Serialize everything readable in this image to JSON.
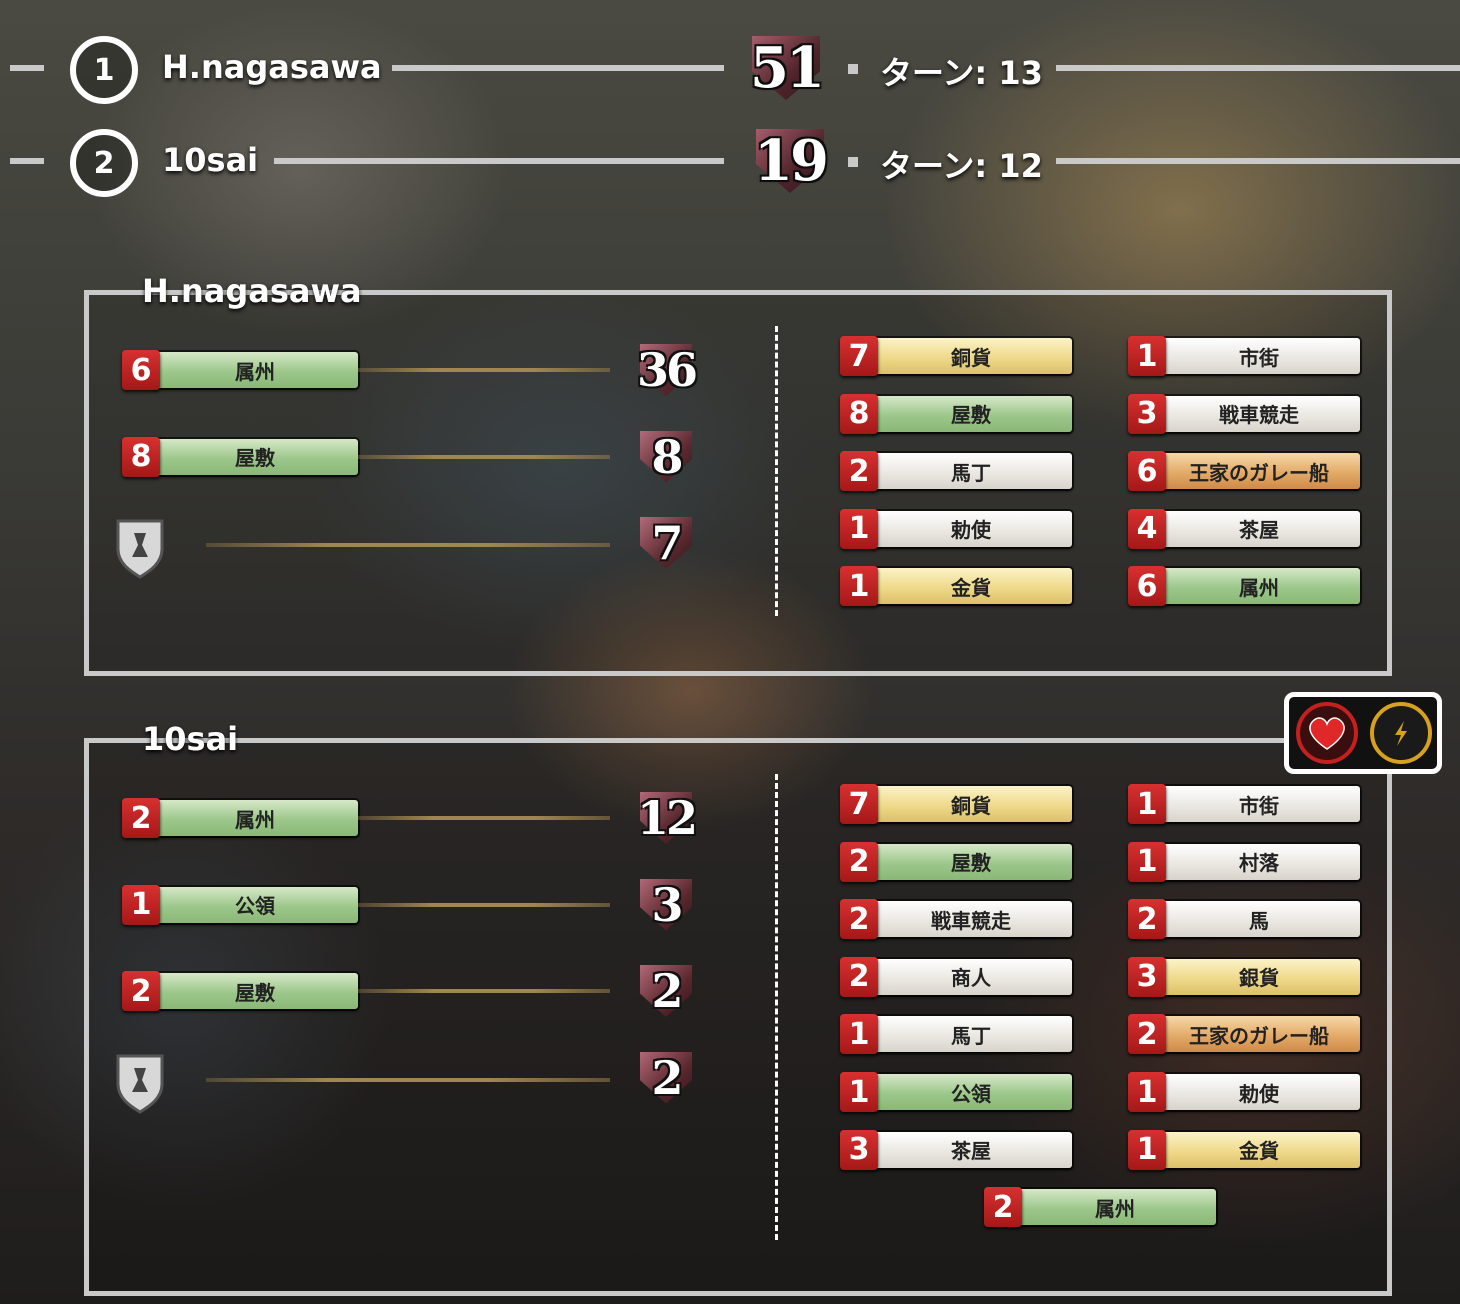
{
  "ranking": [
    {
      "rank": "1",
      "name": "H.nagasawa",
      "score": "51",
      "turn_label": "ターン: 13"
    },
    {
      "rank": "2",
      "name": "10sai",
      "score": "19",
      "turn_label": "ターン: 12"
    }
  ],
  "players": [
    {
      "name": "H.nagasawa",
      "vp_sources": [
        {
          "count": "6",
          "card": "属州",
          "color": "green",
          "points": "36"
        },
        {
          "count": "8",
          "card": "屋敷",
          "color": "green",
          "points": "8"
        },
        {
          "icon": "vp-token-shield-icon",
          "points": "7"
        }
      ],
      "deck_left": [
        {
          "count": "7",
          "card": "銅貨",
          "color": "yellow"
        },
        {
          "count": "8",
          "card": "屋敷",
          "color": "green"
        },
        {
          "count": "2",
          "card": "馬丁",
          "color": "white"
        },
        {
          "count": "1",
          "card": "勅使",
          "color": "white"
        },
        {
          "count": "1",
          "card": "金貨",
          "color": "yellow"
        }
      ],
      "deck_right": [
        {
          "count": "1",
          "card": "市街",
          "color": "white"
        },
        {
          "count": "3",
          "card": "戦車競走",
          "color": "white"
        },
        {
          "count": "6",
          "card": "王家のガレー船",
          "color": "orange"
        },
        {
          "count": "4",
          "card": "茶屋",
          "color": "white"
        },
        {
          "count": "6",
          "card": "属州",
          "color": "green"
        }
      ]
    },
    {
      "name": "10sai",
      "vp_sources": [
        {
          "count": "2",
          "card": "属州",
          "color": "green",
          "points": "12"
        },
        {
          "count": "1",
          "card": "公領",
          "color": "green",
          "points": "3"
        },
        {
          "count": "2",
          "card": "屋敷",
          "color": "green",
          "points": "2"
        },
        {
          "icon": "vp-token-shield-icon",
          "points": "2"
        }
      ],
      "deck_left": [
        {
          "count": "7",
          "card": "銅貨",
          "color": "yellow"
        },
        {
          "count": "2",
          "card": "屋敷",
          "color": "green"
        },
        {
          "count": "2",
          "card": "戦車競走",
          "color": "white"
        },
        {
          "count": "2",
          "card": "商人",
          "color": "white"
        },
        {
          "count": "1",
          "card": "馬丁",
          "color": "white"
        },
        {
          "count": "1",
          "card": "公領",
          "color": "green"
        },
        {
          "count": "3",
          "card": "茶屋",
          "color": "white"
        }
      ],
      "deck_right": [
        {
          "count": "1",
          "card": "市街",
          "color": "white"
        },
        {
          "count": "1",
          "card": "村落",
          "color": "white"
        },
        {
          "count": "2",
          "card": "馬",
          "color": "white"
        },
        {
          "count": "3",
          "card": "銀貨",
          "color": "yellow"
        },
        {
          "count": "2",
          "card": "王家のガレー船",
          "color": "orange"
        },
        {
          "count": "1",
          "card": "勅使",
          "color": "white"
        },
        {
          "count": "1",
          "card": "金貨",
          "color": "yellow"
        }
      ],
      "deck_center": [
        {
          "count": "2",
          "card": "属州",
          "color": "green"
        }
      ]
    }
  ],
  "icons": [
    "heart-icon",
    "lightning-icon"
  ],
  "colors": {
    "count_badge": "#c22020",
    "rule": "#c9c9c9",
    "heart": "#e02828",
    "lightning": "#d6a21e"
  }
}
